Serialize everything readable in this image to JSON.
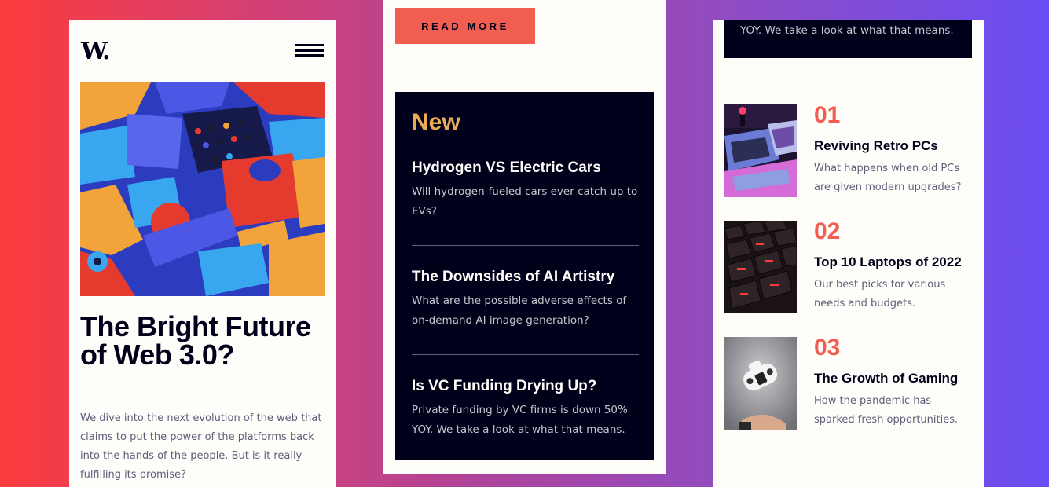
{
  "brand": {
    "logo_text": "W."
  },
  "menu": {
    "icon": "hamburger-menu-icon"
  },
  "hero": {
    "image": "abstract-3d-blocks-image",
    "title": "The Bright Future of Web 3.0?",
    "description": "We dive into the next evolution of the web that claims to put the power of the platforms back into the hands of the people. But is it really fulfilling its promise?",
    "cta_label": "READ MORE"
  },
  "new": {
    "heading": "New",
    "items": [
      {
        "title": "Hydrogen VS Electric Cars",
        "description": "Will hydrogen-fueled cars ever catch up to EVs?"
      },
      {
        "title": "The Downsides of AI Artistry",
        "description": "What are the possible adverse effects of on-demand AI image generation?"
      },
      {
        "title": "Is VC Funding Drying Up?",
        "description": "Private funding by VC firms is down 50% YOY. We take a look at what that means."
      }
    ]
  },
  "top_snippet": {
    "text": "YOY. We take a look at what that means."
  },
  "ranked": [
    {
      "number": "01",
      "title": "Reviving Retro PCs",
      "description": "What happens when old PCs are given modern upgrades?",
      "image": "retro-pcs-image"
    },
    {
      "number": "02",
      "title": "Top 10 Laptops of 2022",
      "description": "Our best picks for various needs and budgets.",
      "image": "laptop-keyboard-image"
    },
    {
      "number": "03",
      "title": "The Growth of Gaming",
      "description": "How the pandemic has sparked fresh opportunities.",
      "image": "gaming-controller-image"
    }
  ],
  "colors": {
    "soft_red": "#f15e50",
    "soft_orange": "#e9ab53",
    "off_white": "#fffdfa",
    "very_dark_blue": "#00001a",
    "grayish_blue": "#c5c6ce",
    "dark_grayish_blue": "#5d5f79"
  }
}
